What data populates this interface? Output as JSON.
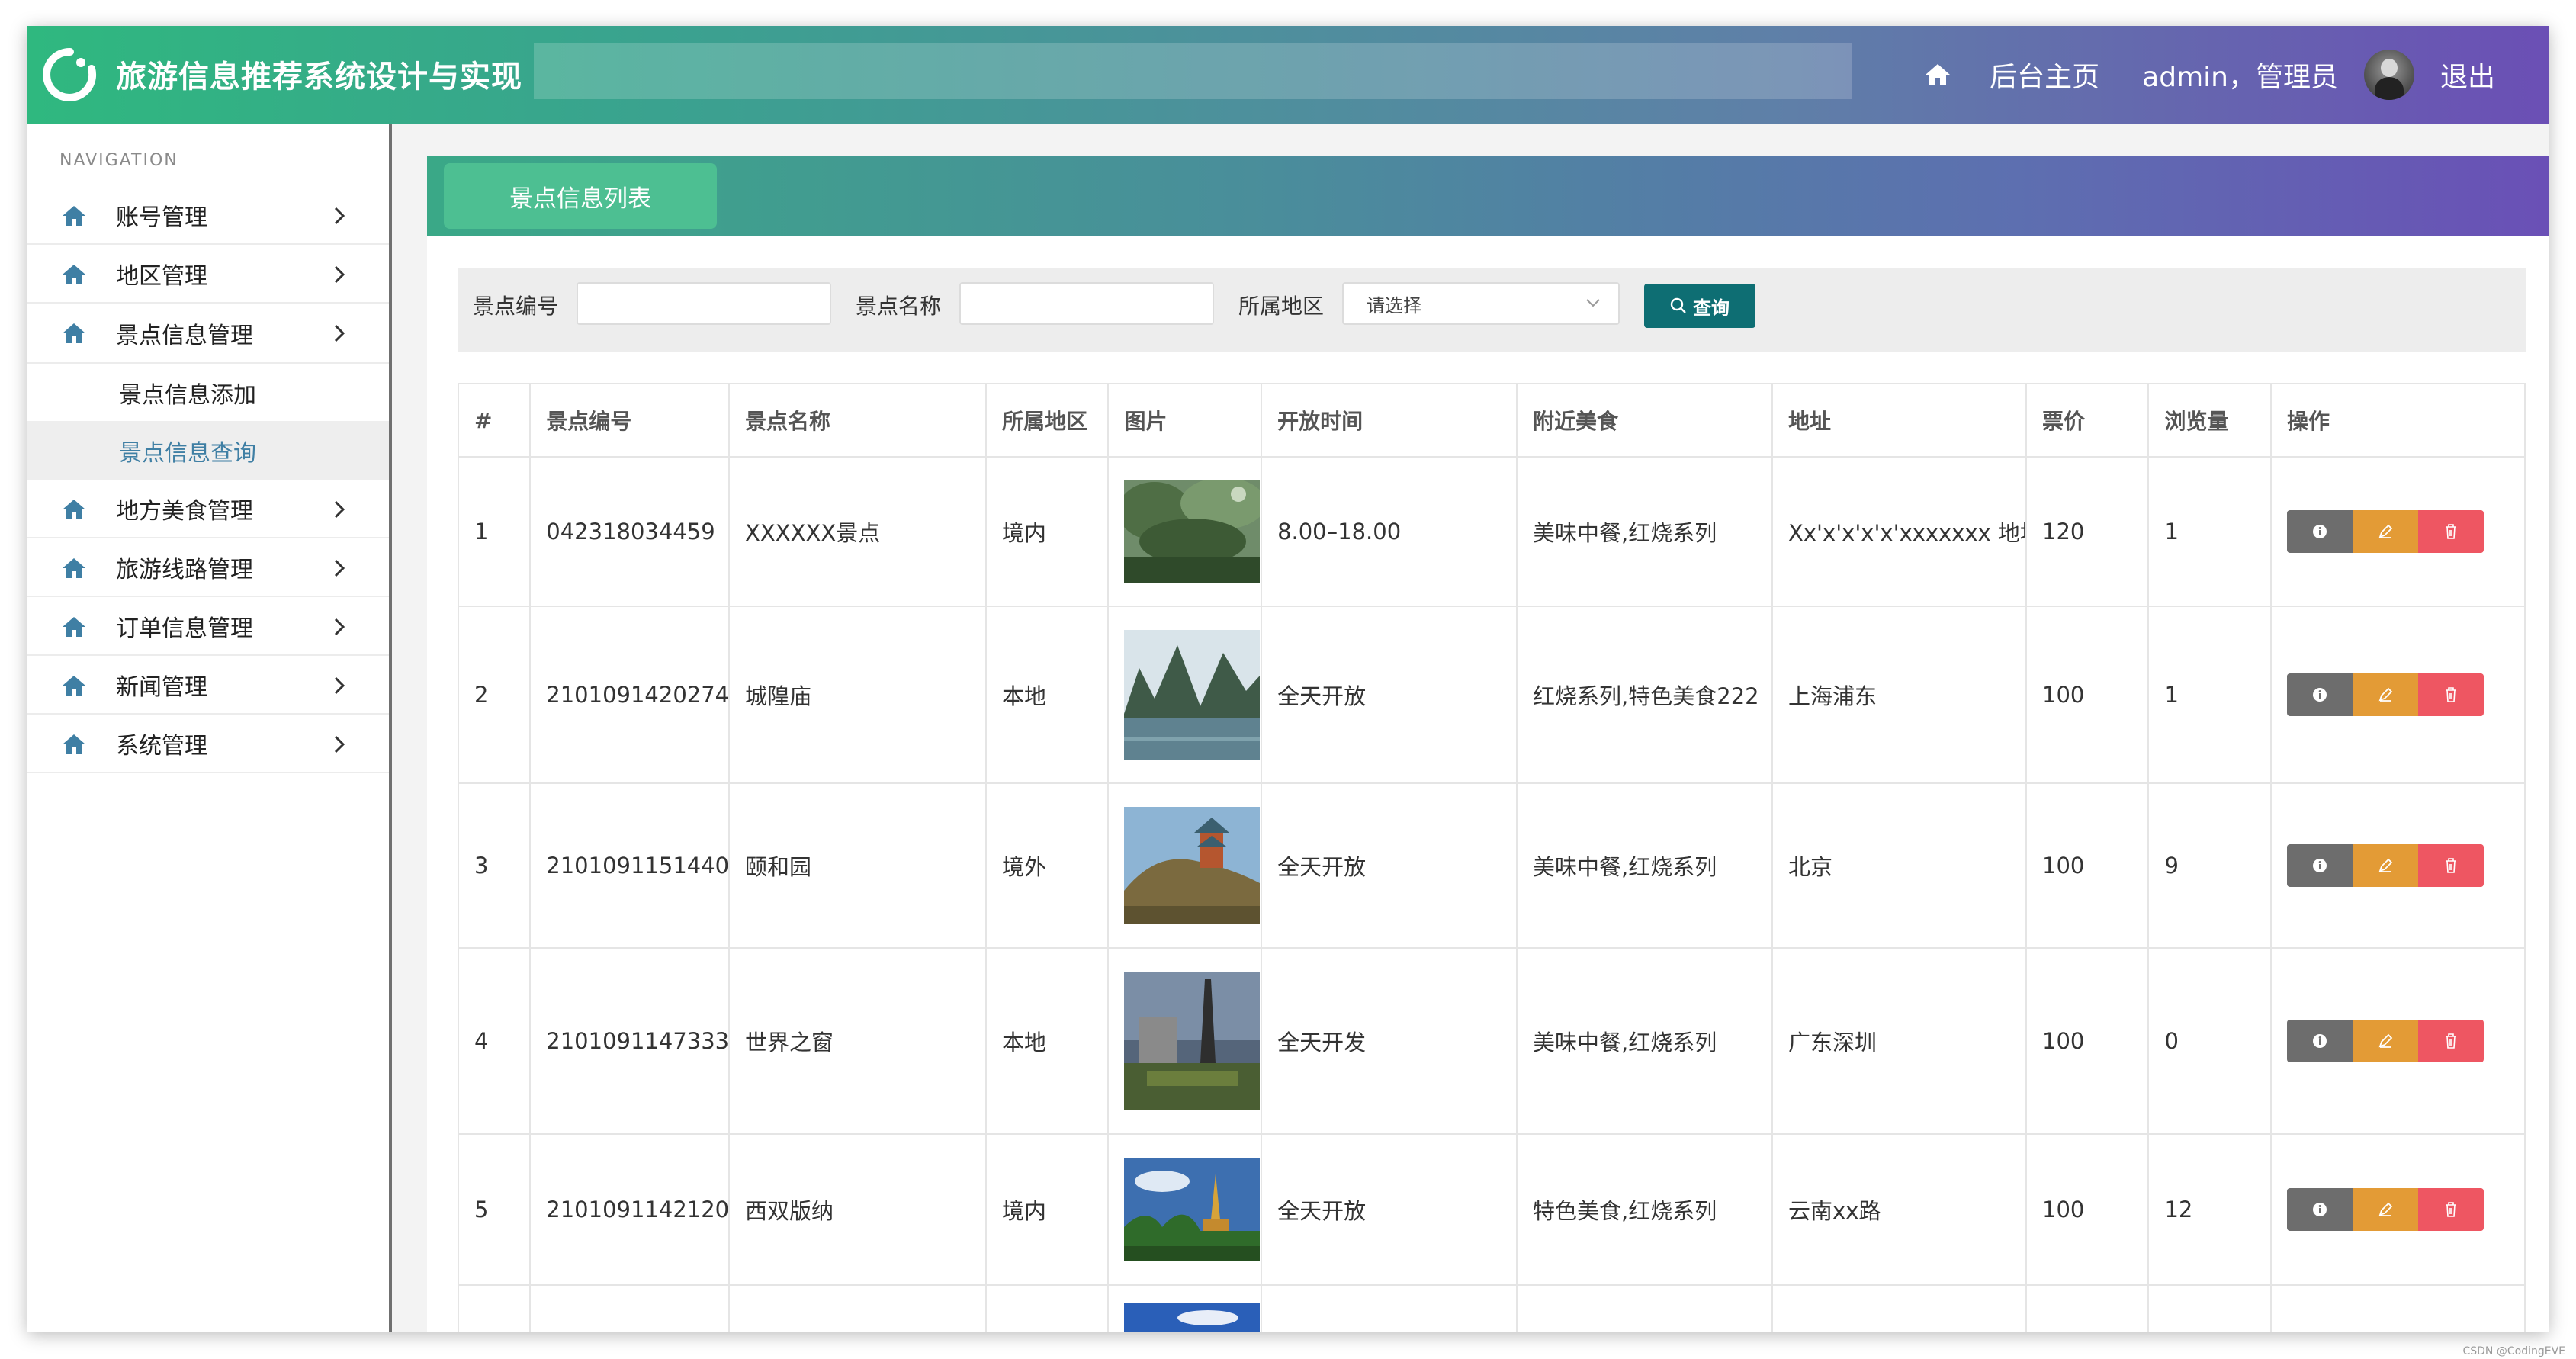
{
  "header": {
    "title": "旅游信息推荐系统设计与实现",
    "home_link": "后台主页",
    "user": "admin，管理员",
    "logout": "退出"
  },
  "sidebar": {
    "heading": "NAVIGATION",
    "items": [
      {
        "label": "账号管理",
        "icon": "home-icon"
      },
      {
        "label": "地区管理",
        "icon": "home-icon"
      },
      {
        "label": "景点信息管理",
        "icon": "home-icon"
      },
      {
        "label": "地方美食管理",
        "icon": "home-icon"
      },
      {
        "label": "旅游线路管理",
        "icon": "home-icon"
      },
      {
        "label": "订单信息管理",
        "icon": "home-icon"
      },
      {
        "label": "新闻管理",
        "icon": "home-icon"
      },
      {
        "label": "系统管理",
        "icon": "home-icon"
      }
    ],
    "sub_items": [
      {
        "label": "景点信息添加"
      },
      {
        "label": "景点信息查询",
        "active": true
      }
    ]
  },
  "panel": {
    "tab_label": "景点信息列表"
  },
  "search": {
    "code_label": "景点编号",
    "name_label": "景点名称",
    "region_label": "所属地区",
    "region_value": "请选择",
    "query_label": "查询"
  },
  "table": {
    "columns": [
      "#",
      "景点编号",
      "景点名称",
      "所属地区",
      "图片",
      "开放时间",
      "附近美食",
      "地址",
      "票价",
      "浏览量",
      "操作"
    ],
    "rows": [
      {
        "no": "1",
        "code": "042318034459",
        "name": "XXXXXX景点",
        "region": "境内",
        "image": "forest-trees",
        "hours": "8.00–18.00",
        "food": "美味中餐,红烧系列",
        "address": "Xx'x'x'x'x'xxxxxxx 地址",
        "price": "120",
        "views": "1"
      },
      {
        "no": "2",
        "code": "2101091420274",
        "name": "城隍庙",
        "region": "本地",
        "image": "karst-river",
        "hours": "全天开放",
        "food": "红烧系列,特色美食222",
        "address": "上海浦东",
        "price": "100",
        "views": "1"
      },
      {
        "no": "3",
        "code": "2101091151440",
        "name": "颐和园",
        "region": "境外",
        "image": "palace-hill",
        "hours": "全天开放",
        "food": "美味中餐,红烧系列",
        "address": "北京",
        "price": "100",
        "views": "9"
      },
      {
        "no": "4",
        "code": "2101091147333",
        "name": "世界之窗",
        "region": "本地",
        "image": "tower-park",
        "hours": "全天开发",
        "food": "美味中餐,红烧系列",
        "address": "广东深圳",
        "price": "100",
        "views": "0"
      },
      {
        "no": "5",
        "code": "2101091142120",
        "name": "西双版纳",
        "region": "境内",
        "image": "pagoda-palms",
        "hours": "全天开放",
        "food": "特色美食,红烧系列",
        "address": "云南xx路",
        "price": "100",
        "views": "12"
      }
    ]
  },
  "watermark": "CSDN @CodingEVE",
  "colors": {
    "header_start": "#2fb87f",
    "header_end": "#6b4fb5",
    "query_button": "#0e6e73",
    "op_info": "#6d6d6d",
    "op_edit": "#e39b36",
    "op_delete": "#ee5662",
    "active_sub": "#3f7fa4"
  }
}
